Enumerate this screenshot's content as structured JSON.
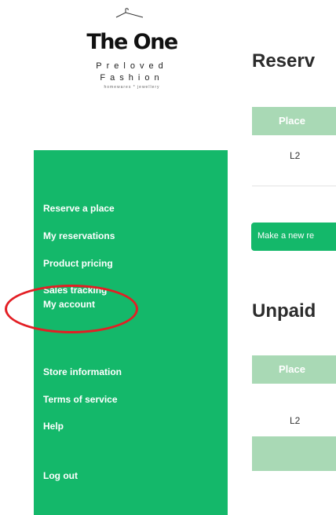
{
  "logo": {
    "main": "The One",
    "line1": "Preloved",
    "line2": "Fashion",
    "tagline": "homewares * jewellery"
  },
  "sidebar": {
    "items": [
      {
        "label": "Reserve a place"
      },
      {
        "label": "My reservations"
      },
      {
        "label": "Product pricing"
      },
      {
        "label": "Sales tracking"
      },
      {
        "label": "My account"
      },
      {
        "label": "Store information"
      },
      {
        "label": "Terms of service"
      },
      {
        "label": "Help"
      },
      {
        "label": "Log out"
      }
    ]
  },
  "reservations": {
    "title": "Reserv",
    "column_place": "Place",
    "rows": [
      {
        "place": "L2"
      }
    ],
    "new_button": "Make a new re"
  },
  "unpaid": {
    "title": "Unpaid",
    "column_place": "Place",
    "rows": [
      {
        "place": "L2"
      }
    ]
  },
  "colors": {
    "brand_green": "#14b86a",
    "pale_green": "#a9d9b5",
    "annotation_red": "#e31e24"
  }
}
